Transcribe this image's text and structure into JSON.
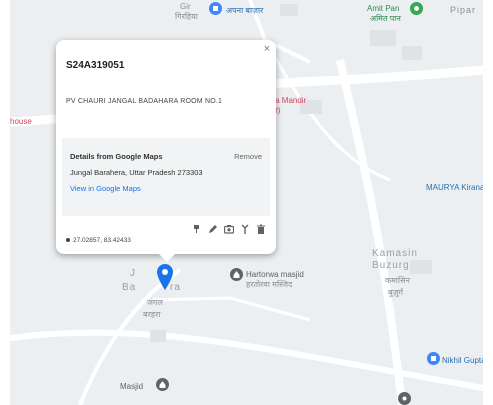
{
  "map": {
    "labels": {
      "top_place": "Gir",
      "top_place_hindi": "गिरहिया",
      "top_pin_hindi": "अपना बाज़ार",
      "amit_pan": "Amit Pan",
      "amit_pan_hindi": "अमित पान",
      "pipar": "Pipar",
      "house": "house",
      "durga_mandir": "rga Mandir",
      "durga_mandir_sub": "रवा)",
      "maurya_kirana": "MAURYA Kirana",
      "hartorwa_masjid": "Hartorwa masjid",
      "hartorwa_masjid_hindi": "हरतोरवा मस्जिद",
      "kamasin": "Kamasin",
      "buzurg": "Buzurg",
      "kamasin_hindi": "कमासिन",
      "buzurg_hindi": "बुज़ुर्ग",
      "jangal_1": "J",
      "jangal_2": "Ba",
      "jangal_3": "ra",
      "jangal_hindi_1": "जंगल",
      "jangal_hindi_2": "बरहरा",
      "nikhil_gupta": "Nikhil Gupta",
      "masjid": "Masjid"
    },
    "colors": {
      "poi_blue": "#4285f4",
      "poi_green": "#34a853",
      "poi_red": "#e8546f",
      "poi_grey": "#5f6368",
      "pin": "#1a73e8"
    }
  },
  "popup": {
    "close_label": "×",
    "title": "S24A319051",
    "address": "PV CHAURI JANGAL BADAHARA ROOM NO.1",
    "google": {
      "header": "Details from Google Maps",
      "remove_label": "Remove",
      "address": "Jungal Barahera, Uttar Pradesh 273303",
      "link_label": "View in Google Maps"
    },
    "coordinates": "27.02857, 83.42433",
    "tools": [
      "paint-icon",
      "pencil-icon",
      "camera-icon",
      "route-icon",
      "trash-icon"
    ]
  }
}
